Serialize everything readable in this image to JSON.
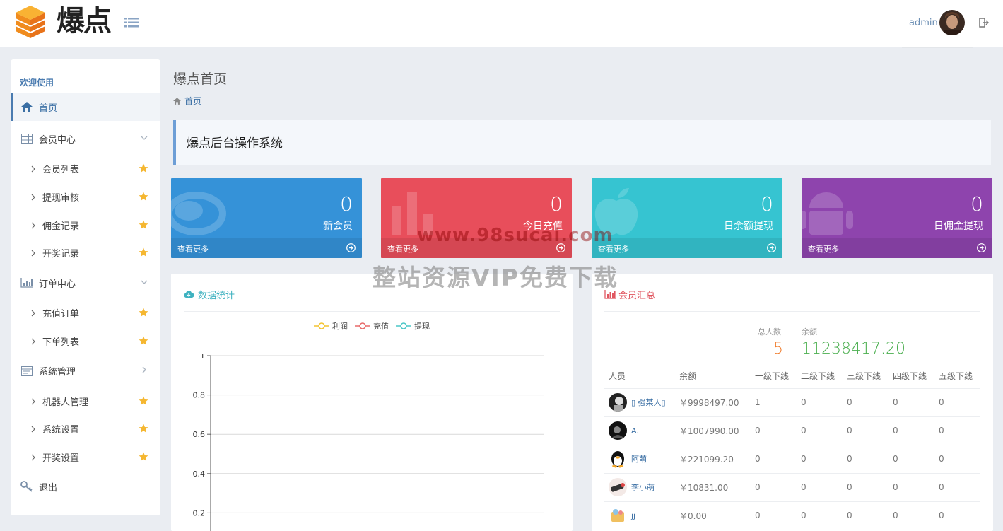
{
  "app": {
    "logo_text": "爆点",
    "admin_name": "admin"
  },
  "sidebar": {
    "welcome": "欢迎使用",
    "home": "首页",
    "member_center": "会员中心",
    "member_subs": [
      "会员列表",
      "提现审核",
      "佣金记录",
      "开奖记录"
    ],
    "order_center": "订单中心",
    "order_subs": [
      "充值订单",
      "下单列表"
    ],
    "system": "系统管理",
    "system_subs": [
      "机器人管理",
      "系统设置",
      "开奖设置"
    ],
    "logout": "退出"
  },
  "page": {
    "title": "爆点首页",
    "breadcrumb": "首页",
    "notice": "爆点后台操作系统"
  },
  "stats": [
    {
      "value": "0",
      "label": "新会员",
      "more": "查看更多",
      "color": "#3592d8"
    },
    {
      "value": "0",
      "label": "今日充值",
      "more": "查看更多",
      "color": "#e84e5b"
    },
    {
      "value": "0",
      "label": "日余额提现",
      "more": "查看更多",
      "color": "#36c4d1"
    },
    {
      "value": "0",
      "label": "日佣金提现",
      "more": "查看更多",
      "color": "#8e44ad"
    }
  ],
  "data_panel": {
    "title": "数据统计",
    "legend": [
      {
        "name": "利润",
        "color": "#f4c431"
      },
      {
        "name": "充值",
        "color": "#e86a6a"
      },
      {
        "name": "提现",
        "color": "#4cc7c7"
      }
    ]
  },
  "chart_data": {
    "type": "line",
    "series": [
      {
        "name": "利润",
        "values": []
      },
      {
        "name": "充值",
        "values": []
      },
      {
        "name": "提现",
        "values": []
      }
    ],
    "yticks": [
      "1",
      "0.8",
      "0.6",
      "0.4",
      "0.2"
    ],
    "ylim": [
      0,
      1
    ],
    "grid": true
  },
  "member_panel": {
    "title": "会员汇总",
    "total_label": "总人数",
    "total_value": "5",
    "balance_label": "余额",
    "balance_value": "11238417.20",
    "headers": [
      "人员",
      "余额",
      "一级下线",
      "二级下线",
      "三级下线",
      "四级下线",
      "五级下线"
    ],
    "rows": [
      {
        "name": "▯ 强某人▯",
        "balance": "￥9998497.00",
        "l1": "1",
        "l2": "0",
        "l3": "0",
        "l4": "0",
        "l5": "0"
      },
      {
        "name": "A.",
        "balance": "￥1007990.00",
        "l1": "0",
        "l2": "0",
        "l3": "0",
        "l4": "0",
        "l5": "0"
      },
      {
        "name": "阿萌",
        "balance": "￥221099.20",
        "l1": "0",
        "l2": "0",
        "l3": "0",
        "l4": "0",
        "l5": "0"
      },
      {
        "name": "李小萌",
        "balance": "￥10831.00",
        "l1": "0",
        "l2": "0",
        "l3": "0",
        "l4": "0",
        "l5": "0"
      },
      {
        "name": "jj",
        "balance": "￥0.00",
        "l1": "0",
        "l2": "0",
        "l3": "0",
        "l4": "0",
        "l5": "0"
      }
    ]
  },
  "watermark": {
    "url": "www.98sucai.com",
    "text": "整站资源VIP免费下载"
  }
}
